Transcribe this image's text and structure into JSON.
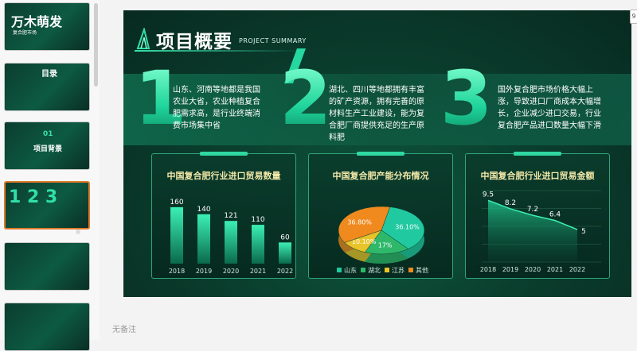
{
  "thumbnails": [
    {
      "title": "万木萌发",
      "sub": "复合肥市场"
    },
    {
      "title": "目录",
      "sub": ""
    },
    {
      "title": "项目背景",
      "sub": "01"
    },
    {
      "title": "",
      "sub": ""
    },
    {
      "title": "",
      "sub": ""
    },
    {
      "title": "",
      "sub": ""
    }
  ],
  "slide": {
    "title": "项目概要",
    "subtitle": "PROJECT SUMMARY",
    "points": [
      {
        "num": "1",
        "text": "山东、河南等地都是我国农业大省，农业种植复合肥需求高，是行业终端消费市场集中省"
      },
      {
        "num": "2",
        "text": "湖北、四川等地都拥有丰富的矿产资源，拥有完善的原材料生产工业建设，能为复合肥厂商提供充足的生产原料肥"
      },
      {
        "num": "3",
        "text": "国外复合肥市场价格大幅上涨，导致进口厂商成本大幅增长，企业减少进口交易，行业复合肥产品进口数量大幅下滑"
      }
    ]
  },
  "notes": "无备注",
  "edge_label": "9",
  "colors": {
    "accent": "#25d8a0",
    "card_title": "#f5e9a8"
  },
  "chart_data": [
    {
      "type": "bar",
      "title": "中国复合肥行业进口贸易数量",
      "categories": [
        "2018",
        "2019",
        "2020",
        "2021",
        "2022"
      ],
      "values": [
        160,
        140,
        121,
        110,
        60
      ],
      "ylim": [
        0,
        180
      ],
      "grid": false
    },
    {
      "type": "pie",
      "title": "中国复合肥产能分布情况",
      "categories": [
        "山东",
        "湖北",
        "江苏",
        "其他"
      ],
      "values": [
        36.1,
        17.0,
        10.1,
        36.8
      ],
      "labels": [
        "36.10%",
        "17%",
        "10.10%",
        "36.80%"
      ],
      "colors": [
        "#21c9a0",
        "#2fb86a",
        "#e8c42a",
        "#f08a1e"
      ],
      "legend": "bottom"
    },
    {
      "type": "area",
      "title": "中国复合肥行业进口贸易金额",
      "categories": [
        "2018",
        "2019",
        "2020",
        "2021",
        "2022"
      ],
      "values": [
        9.5,
        8.2,
        7.2,
        6.4,
        5
      ],
      "ylim": [
        0,
        11
      ],
      "grid": true
    }
  ]
}
